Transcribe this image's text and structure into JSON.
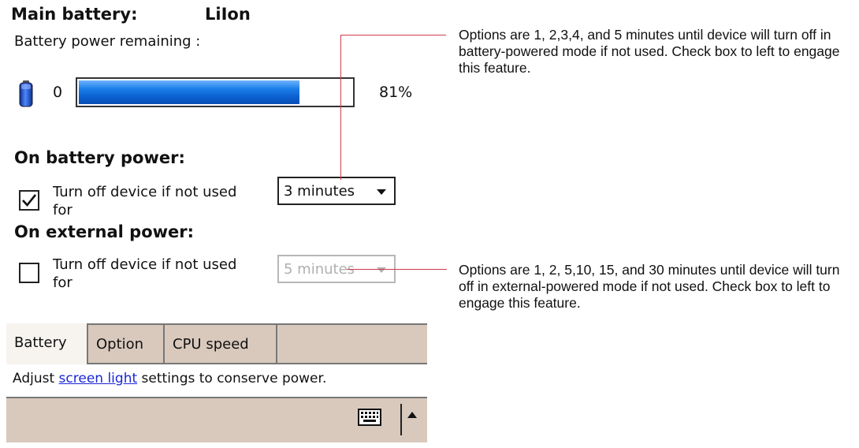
{
  "battery": {
    "main_label": "Main battery:",
    "type": "LiIon",
    "remaining_label": "Battery power remaining :",
    "min_label": "0",
    "percent": 81,
    "percent_label": "81%"
  },
  "on_battery": {
    "heading": "On battery power:",
    "checked": true,
    "option_text": "Turn off device if not used for",
    "dropdown_value": "3 minutes",
    "enabled": true
  },
  "on_external": {
    "heading": "On external power:",
    "checked": false,
    "option_text": "Turn off device if not used for",
    "dropdown_value": "5 minutes",
    "enabled": false
  },
  "tabs": [
    {
      "label": "Battery",
      "active": true
    },
    {
      "label": "Option",
      "active": false
    },
    {
      "label": "CPU speed",
      "active": false
    }
  ],
  "hint": {
    "prefix": "Adjust ",
    "link": "screen light",
    "suffix": " settings to conserve power."
  },
  "callouts": {
    "battery_mode": "Options are 1, 2,3,4, and 5 minutes until device will turn off in battery-powered mode if not used. Check box to left to engage this feature.",
    "external_mode": "Options are 1, 2, 5,10, 15, and 30 minutes until device will turn off in external-powered mode if not used. Check box to left to engage this feature."
  },
  "icons": {
    "battery": "battery-icon",
    "keyboard": "keyboard-icon",
    "checkmark": "checkmark-icon",
    "dropdown": "chevron-down-icon",
    "up": "chevron-up-icon"
  },
  "colors": {
    "progress_fill": "#1b7fe8",
    "tab_bar": "#d9c9bd",
    "link": "#1b27d6",
    "callout_line": "#d23a4a",
    "disabled_text": "#b0b0b0"
  }
}
